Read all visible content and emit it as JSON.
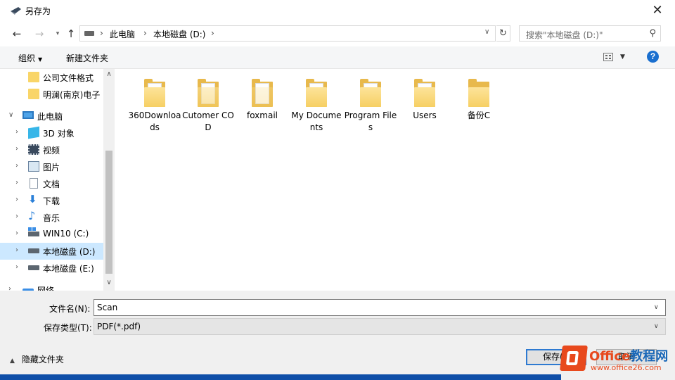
{
  "window": {
    "title": "另存为",
    "close_glyph": "✕"
  },
  "address": {
    "segments": [
      "此电脑",
      "本地磁盘 (D:)"
    ],
    "search_placeholder": "搜索\"本地磁盘 (D:)\""
  },
  "toolbar": {
    "organize_label": "组织",
    "new_folder_label": "新建文件夹",
    "help_glyph": "?"
  },
  "nav": {
    "items": [
      {
        "label": "公司文件格式",
        "icon": "folder-icon"
      },
      {
        "label": "明澜(南京)电子",
        "icon": "folder-icon"
      },
      {
        "label": "此电脑",
        "icon": "computer-icon"
      },
      {
        "label": "3D 对象",
        "icon": "3d-objects-icon"
      },
      {
        "label": "视频",
        "icon": "video-icon"
      },
      {
        "label": "图片",
        "icon": "pictures-icon"
      },
      {
        "label": "文档",
        "icon": "documents-icon"
      },
      {
        "label": "下载",
        "icon": "download-icon"
      },
      {
        "label": "音乐",
        "icon": "music-icon"
      },
      {
        "label": "WIN10 (C:)",
        "icon": "system-drive-icon"
      },
      {
        "label": "本地磁盘 (D:)",
        "icon": "drive-icon",
        "selected": true
      },
      {
        "label": "本地磁盘 (E:)",
        "icon": "drive-icon"
      },
      {
        "label": "网络",
        "icon": "network-icon"
      }
    ]
  },
  "files": [
    {
      "name": "360Downloads",
      "icon": "folder-with-files-icon"
    },
    {
      "name": "Cutomer COD",
      "icon": "folder-with-files-icon"
    },
    {
      "name": "foxmail",
      "icon": "folder-with-files-icon"
    },
    {
      "name": "My Documents",
      "icon": "folder-with-files-icon"
    },
    {
      "name": "Program Files",
      "icon": "folder-with-files-icon"
    },
    {
      "name": "Users",
      "icon": "folder-with-files-icon"
    },
    {
      "name": "备份C",
      "icon": "folder-icon"
    }
  ],
  "form": {
    "filename_label": "文件名(N):",
    "filename_value": "Scan",
    "filetype_label": "保存类型(T):",
    "filetype_value": "PDF(*.pdf)"
  },
  "footer": {
    "hide_folders_label": "隐藏文件夹",
    "save_label": "保存(S)",
    "cancel_label": "取消"
  },
  "watermark": {
    "brand_a": "Office",
    "brand_b": "教程网",
    "url": "www.office26.com"
  },
  "colors": {
    "accent": "#2e7ad1",
    "selection": "#cce8ff",
    "folder": "#f6cf63",
    "watermark": "#e8491d"
  }
}
